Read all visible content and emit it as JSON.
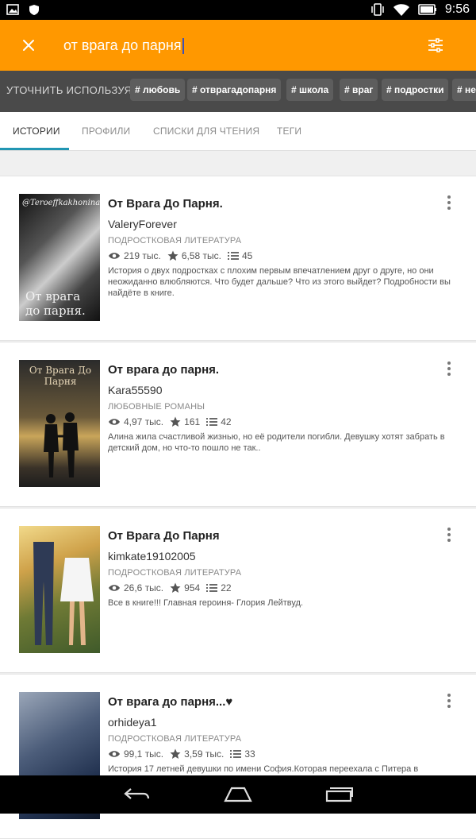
{
  "status_bar": {
    "time": "9:56",
    "icons": [
      "gallery-icon",
      "shield-icon",
      "vibrate-icon",
      "wifi-icon",
      "battery-icon"
    ]
  },
  "search": {
    "query": "от врага до парня",
    "icons": [
      "close-icon",
      "filter-sliders-icon"
    ]
  },
  "tags": {
    "hint": "УТОЧНИТЬ ИСПОЛЬЗУЯ",
    "chips": [
      "# любовь",
      "# отврагадопарня",
      "# школа",
      "# враг",
      "# подростки",
      "# не"
    ]
  },
  "tabs": [
    {
      "label": "ИСТОРИИ",
      "active": true
    },
    {
      "label": "ПРОФИЛИ",
      "active": false
    },
    {
      "label": "СПИСКИ ДЛЯ ЧТЕНИЯ",
      "active": false
    },
    {
      "label": "ТЕГИ",
      "active": false
    }
  ],
  "stories": [
    {
      "title": "От Врага До Парня.",
      "author": "ValeryForever",
      "category": "ПОДРОСТКОВАЯ ЛИТЕРАТУРА",
      "views": "219 тыс.",
      "votes": "6,58 тыс.",
      "parts": "45",
      "description": "История о двух подростках с плохим первым впечатлением друг о друге, но они неожиданно влюбляются. Что будет дальше? Что из этого выйдет? Подробности вы найдёте в книге.",
      "cover_top_text": "@Teroeffkakhonina",
      "cover_text": "От врага до парня."
    },
    {
      "title": "От врага до парня.",
      "author": "Kara55590",
      "category": "ЛЮБОВНЫЕ РОМАНЫ",
      "views": "4,97 тыс.",
      "votes": "161",
      "parts": "42",
      "description": "Алина жила счастливой жизнью, но её родители погибли. Девушку хотят забрать в детский дом, но что-то пошло не так..",
      "cover_text": "От Врага До Парня"
    },
    {
      "title": "От Врага До Парня",
      "author": "kimkate19102005",
      "category": "ПОДРОСТКОВАЯ ЛИТЕРАТУРА",
      "views": "26,6 тыс.",
      "votes": "954",
      "parts": "22",
      "description": "Все в книге!!! Главная героиня- Глория Лейтвуд.",
      "cover_text": ""
    },
    {
      "title": "От врага до парня...♥",
      "author": "orhideya1",
      "category": "ПОДРОСТКОВАЯ ЛИТЕРАТУРА",
      "views": "99,1 тыс.",
      "votes": "3,59 тыс.",
      "parts": "33",
      "description": "История 17 летней девушки по имени София.Которая переехала с Питера в",
      "cover_text": ""
    }
  ],
  "colors": {
    "accent": "#ff9800",
    "tag_bar": "#4a4a4a",
    "tab_underline": "#2196b3"
  }
}
